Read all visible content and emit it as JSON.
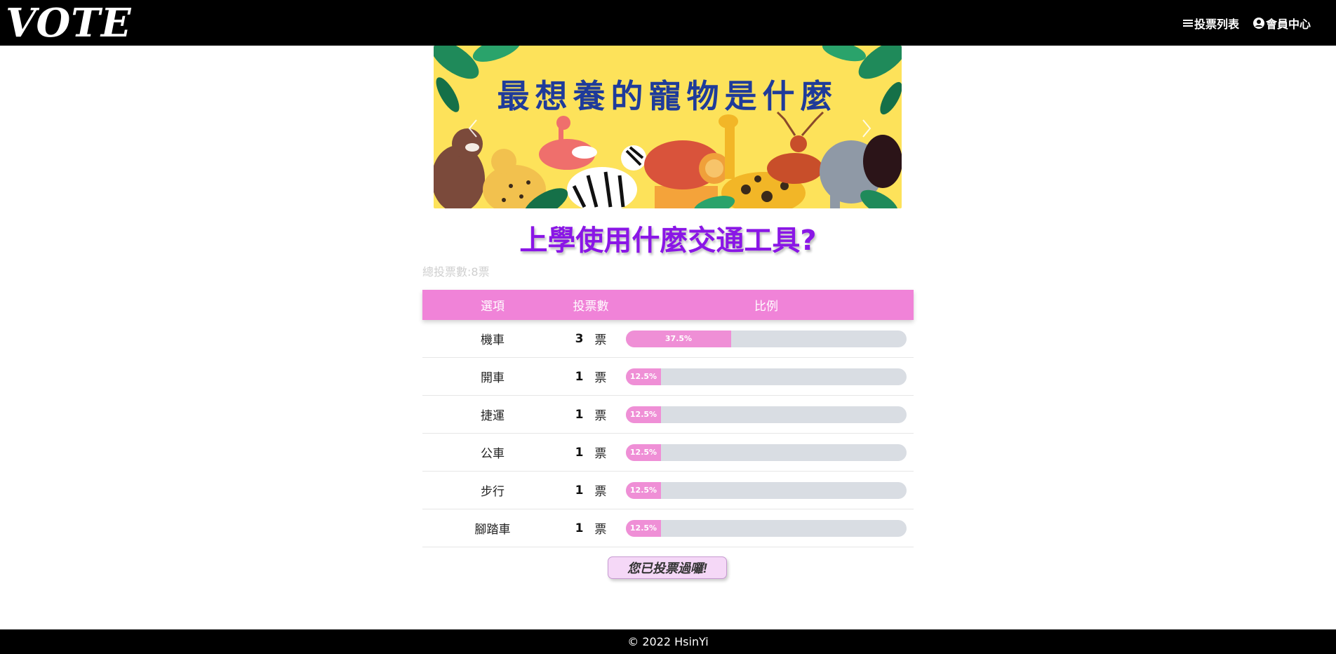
{
  "header": {
    "logo": "VOTE",
    "nav": [
      {
        "label": "投票列表",
        "icon": "list-icon"
      },
      {
        "label": "會員中心",
        "icon": "user-circle-icon"
      }
    ]
  },
  "banner": {
    "title": "最想養的寵物是什麼",
    "prev_icon": "chevron-left-icon",
    "next_icon": "chevron-right-icon"
  },
  "poll": {
    "title": "上學使用什麼交通工具?",
    "total_votes": "總投票數:8票",
    "headers": {
      "option": "選項",
      "count": "投票數",
      "ratio": "比例"
    },
    "unit": "票",
    "rows": [
      {
        "option": "機車",
        "count": "3",
        "percent_label": "37.5%",
        "percent": 37.5
      },
      {
        "option": "開車",
        "count": "1",
        "percent_label": "12.5%",
        "percent": 12.5
      },
      {
        "option": "捷運",
        "count": "1",
        "percent_label": "12.5%",
        "percent": 12.5
      },
      {
        "option": "公車",
        "count": "1",
        "percent_label": "12.5%",
        "percent": 12.5
      },
      {
        "option": "步行",
        "count": "1",
        "percent_label": "12.5%",
        "percent": 12.5
      },
      {
        "option": "腳踏車",
        "count": "1",
        "percent_label": "12.5%",
        "percent": 12.5
      }
    ],
    "voted_label": "您已投票過囉!"
  },
  "footer": {
    "text": "© 2022 HsinYi"
  },
  "colors": {
    "accent": "#f083d8",
    "title": "#8a16e6",
    "bar_track": "#d9dde3",
    "bar_fill": "#ef8fd6"
  }
}
